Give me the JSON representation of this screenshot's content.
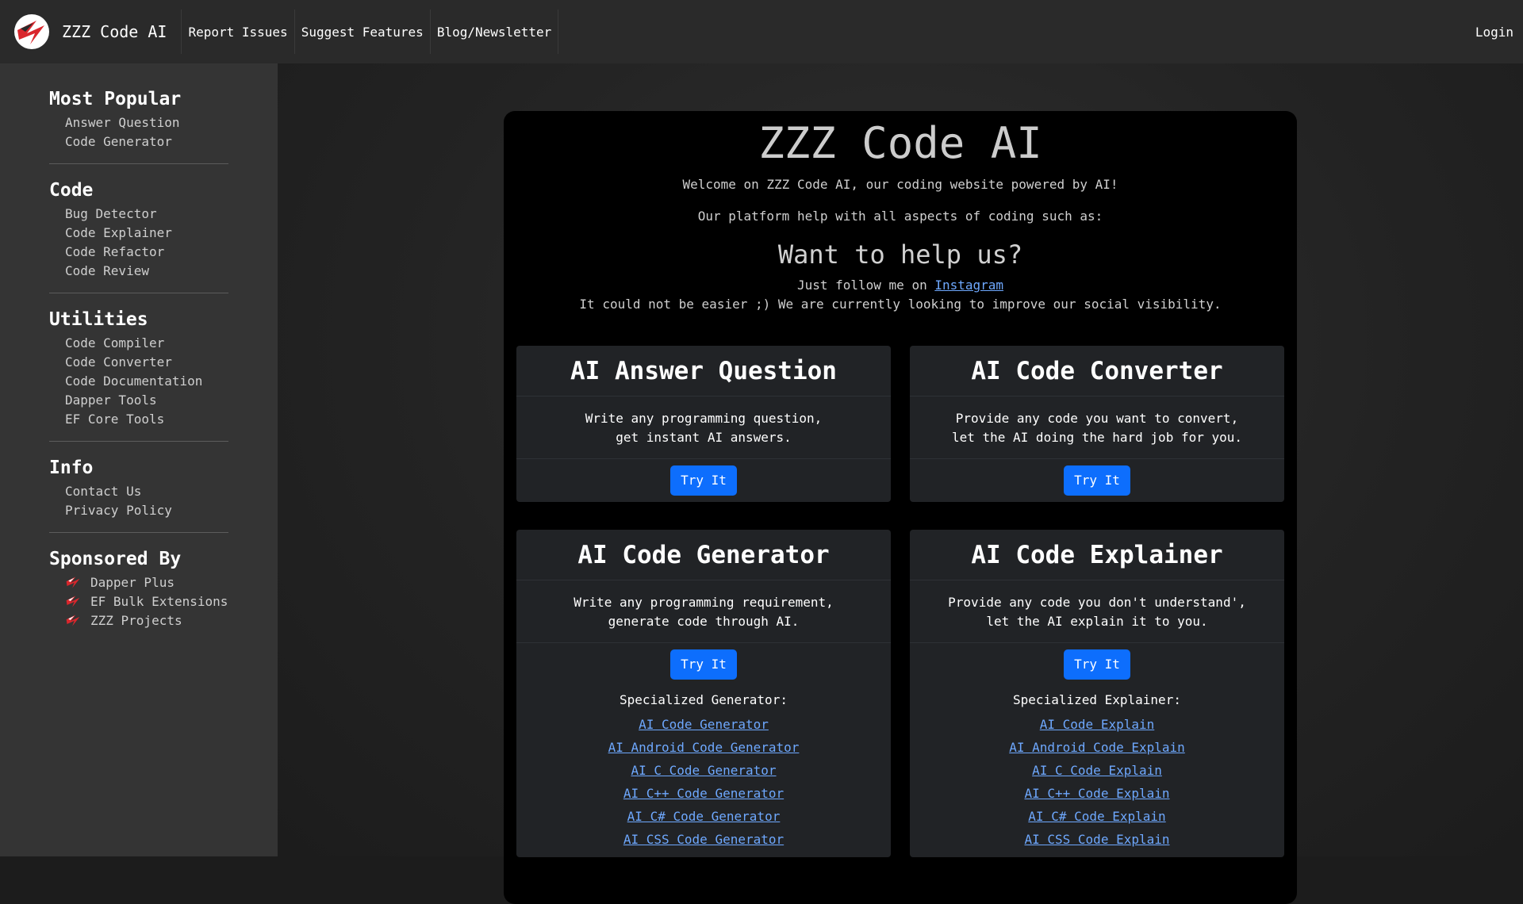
{
  "header": {
    "brand": "ZZZ Code AI",
    "nav": [
      "Report Issues",
      "Suggest Features",
      "Blog/Newsletter"
    ],
    "login": "Login"
  },
  "sidebar": {
    "sections": [
      {
        "title": "Most Popular",
        "items": [
          "Answer Question",
          "Code Generator"
        ]
      },
      {
        "title": "Code",
        "items": [
          "Bug Detector",
          "Code Explainer",
          "Code Refactor",
          "Code Review"
        ]
      },
      {
        "title": "Utilities",
        "items": [
          "Code Compiler",
          "Code Converter",
          "Code Documentation",
          "Dapper Tools",
          "EF Core Tools"
        ]
      },
      {
        "title": "Info",
        "items": [
          "Contact Us",
          "Privacy Policy"
        ]
      }
    ],
    "sponsored": {
      "title": "Sponsored By",
      "items": [
        "Dapper Plus",
        "EF Bulk Extensions",
        "ZZZ Projects"
      ]
    }
  },
  "main": {
    "title": "ZZZ Code AI",
    "welcome": "Welcome on ZZZ Code AI, our coding website powered by AI!",
    "platform": "Our platform help with all aspects of coding such as:",
    "help_title": "Want to help us?",
    "follow_prefix": "Just follow me on ",
    "follow_link": "Instagram",
    "follow_line2": "It could not be easier ;) We are currently looking to improve our social visibility.",
    "cards": [
      {
        "title": "AI Answer Question",
        "desc1": "Write any programming question,",
        "desc2": "get instant AI answers.",
        "button": "Try It"
      },
      {
        "title": "AI Code Converter",
        "desc1": "Provide any code you want to convert,",
        "desc2": "let the AI doing the hard job for you.",
        "button": "Try It"
      },
      {
        "title": "AI Code Generator",
        "desc1": "Write any programming requirement,",
        "desc2": "generate code through AI.",
        "button": "Try It",
        "spec_title": "Specialized Generator:",
        "links": [
          "AI Code Generator",
          "AI Android Code Generator",
          "AI C Code Generator",
          "AI C++ Code Generator",
          "AI C# Code Generator",
          "AI CSS Code Generator"
        ]
      },
      {
        "title": "AI Code Explainer",
        "desc1": "Provide any code you don't understand',",
        "desc2": "let the AI explain it to you.",
        "button": "Try It",
        "spec_title": "Specialized Explainer:",
        "links": [
          "AI Code Explain",
          "AI Android Code Explain",
          "AI C Code Explain",
          "AI C++ Code Explain",
          "AI C# Code Explain",
          "AI CSS Code Explain"
        ]
      }
    ]
  },
  "colors": {
    "accent": "#0d6efd",
    "link": "#6ea8fe",
    "topbar": "#2a2a2a",
    "sidebar": "#343434",
    "card": "#212326",
    "logo_red": "#d9262c"
  },
  "icons": {
    "brand": "zzz-lightning-logo",
    "sponsor": "zzz-lightning-logo"
  }
}
